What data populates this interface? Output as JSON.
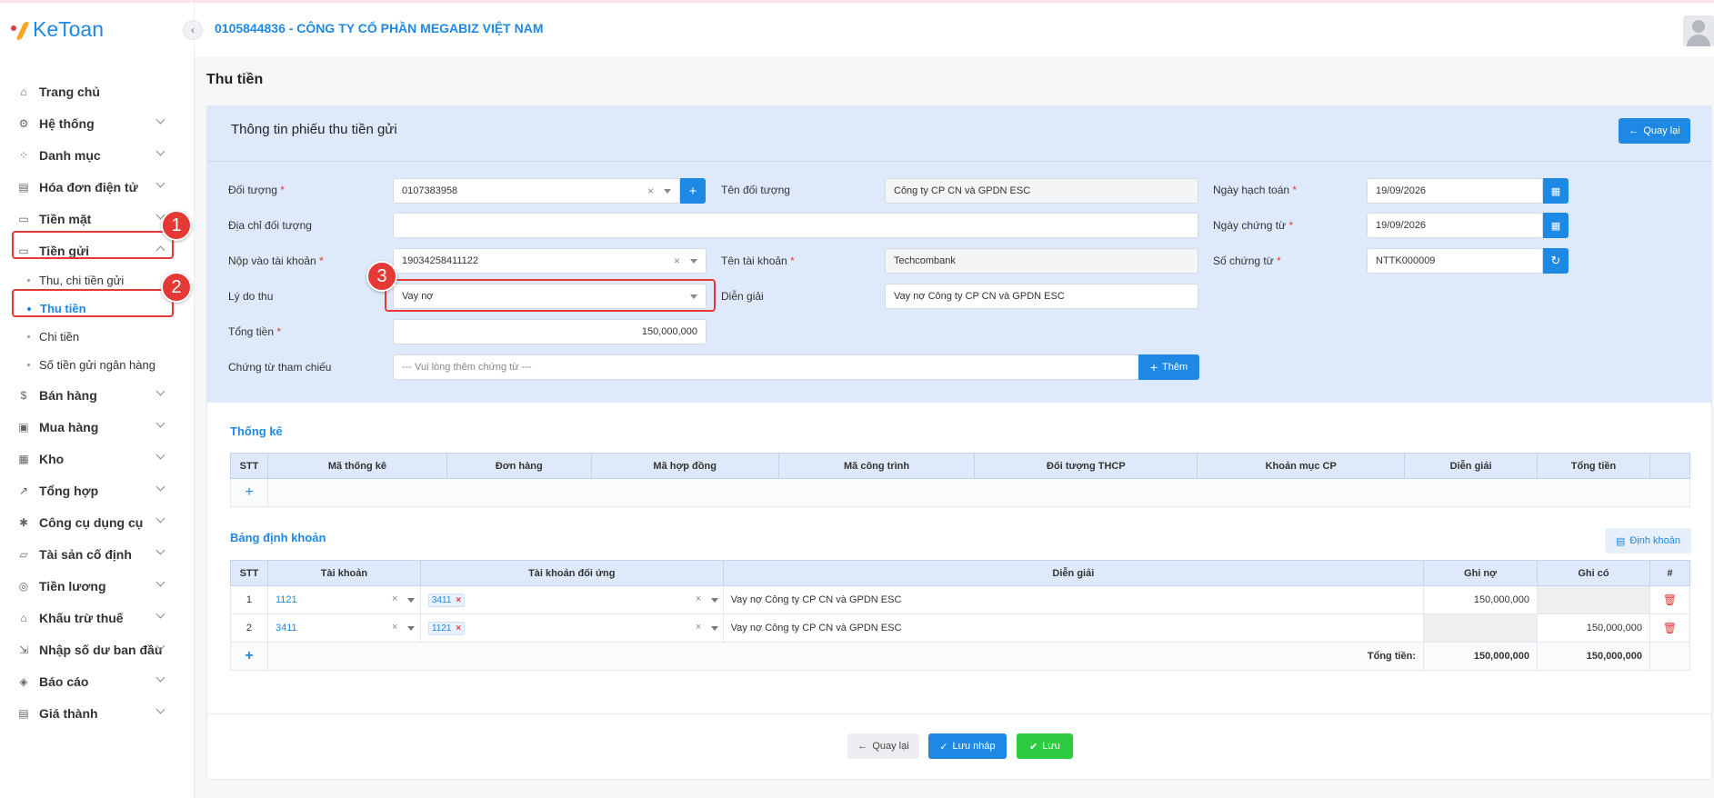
{
  "app": {
    "logo": "KeToan"
  },
  "header": {
    "company": "0105844836 - CÔNG TY CỔ PHẦN MEGABIZ VIỆT NAM"
  },
  "sidebar": {
    "items": [
      {
        "label": "Trang chủ",
        "icon": "home-icon"
      },
      {
        "label": "Hệ thống",
        "icon": "gear-icon"
      },
      {
        "label": "Danh mục",
        "icon": "grid-icon"
      },
      {
        "label": "Hóa đơn điện tử",
        "icon": "invoice-icon"
      },
      {
        "label": "Tiền mặt",
        "icon": "cash-icon"
      },
      {
        "label": "Tiền gửi",
        "icon": "card-icon"
      },
      {
        "label": "Bán hàng",
        "icon": "sell-icon"
      },
      {
        "label": "Mua hàng",
        "icon": "cart-icon"
      },
      {
        "label": "Kho",
        "icon": "warehouse-icon"
      },
      {
        "label": "Tổng hợp",
        "icon": "chart-icon"
      },
      {
        "label": "Công cụ dụng cụ",
        "icon": "tools-icon"
      },
      {
        "label": "Tài sản cố định",
        "icon": "car-icon"
      },
      {
        "label": "Tiền lương",
        "icon": "salary-icon"
      },
      {
        "label": "Khấu trừ thuế",
        "icon": "bank-icon"
      },
      {
        "label": "Nhập số dư ban đầu",
        "icon": "import-icon"
      },
      {
        "label": "Báo cáo",
        "icon": "report-icon"
      },
      {
        "label": "Giá thành",
        "icon": "price-icon"
      }
    ],
    "subitems": [
      "Thu, chi tiền gửi",
      "Thu tiền",
      "Chi tiền",
      "Số tiền gửi ngân hàng"
    ]
  },
  "annotations": [
    "1",
    "2",
    "3"
  ],
  "page": {
    "title": "Thu tiền"
  },
  "form": {
    "card_title": "Thông tin phiếu thu tiền gửi",
    "back_button": "Quay lại",
    "doi_tuong_label": "Đối tượng",
    "doi_tuong_value": "0107383958",
    "ten_doi_tuong_label": "Tên đối tượng",
    "ten_doi_tuong_value": "Công ty CP CN và GPDN ESC",
    "ngay_hach_toan_label": "Ngày hạch toán",
    "ngay_hach_toan_value": "19/09/2026",
    "dia_chi_label": "Địa chỉ đối tượng",
    "dia_chi_value": "",
    "ngay_chung_tu_label": "Ngày chứng từ",
    "ngay_chung_tu_value": "19/09/2026",
    "nop_vao_tk_label": "Nộp vào tài khoản",
    "nop_vao_tk_value": "19034258411122",
    "ten_tk_label": "Tên tài khoản",
    "ten_tk_value": "Techcombank",
    "so_chung_tu_label": "Số chứng từ",
    "so_chung_tu_value": "NTTK000009",
    "ly_do_thu_label": "Lý do thu",
    "ly_do_thu_value": "Vay nợ",
    "dien_giai_label": "Diễn giải",
    "dien_giai_value": "Vay nợ Công ty CP CN và GPDN ESC",
    "tong_tien_label": "Tổng tiền",
    "tong_tien_value": "150,000,000",
    "chung_tu_tham_chieu_label": "Chứng từ tham chiếu",
    "chung_tu_tham_chieu_placeholder": "--- Vui lòng thêm chứng từ ---",
    "them_button": "Thêm"
  },
  "thong_ke": {
    "title": "Thống kê",
    "columns": [
      "STT",
      "Mã thống kê",
      "Đơn hàng",
      "Mã hợp đồng",
      "Mã công trình",
      "Đối tượng THCP",
      "Khoản mục CP",
      "Diễn giải",
      "Tổng tiền",
      ""
    ],
    "add": "+"
  },
  "dinh_khoan": {
    "title": "Bảng định khoản",
    "button": "Định khoản",
    "columns": [
      "STT",
      "Tài khoản",
      "Tài khoản đối ứng",
      "Diễn giải",
      "Ghi nợ",
      "Ghi có",
      "#"
    ],
    "rows": [
      {
        "stt": "1",
        "tk": "1121",
        "tk_du": "3411",
        "dien_giai": "Vay nợ Công ty CP CN và GPDN ESC",
        "ghi_no": "150,000,000",
        "ghi_co": ""
      },
      {
        "stt": "2",
        "tk": "3411",
        "tk_du": "1121",
        "dien_giai": "Vay nợ Công ty CP CN và GPDN ESC",
        "ghi_no": "",
        "ghi_co": "150,000,000"
      }
    ],
    "add": "+",
    "total_label": "Tổng tiền:",
    "total_no": "150,000,000",
    "total_co": "150,000,000"
  },
  "footer": {
    "back": "Quay lại",
    "draft": "Lưu nháp",
    "save": "Lưu"
  },
  "colors": {
    "accent": "#1e88e5",
    "danger": "#e53935",
    "success": "#2ecc40",
    "panel": "#deeafb"
  }
}
